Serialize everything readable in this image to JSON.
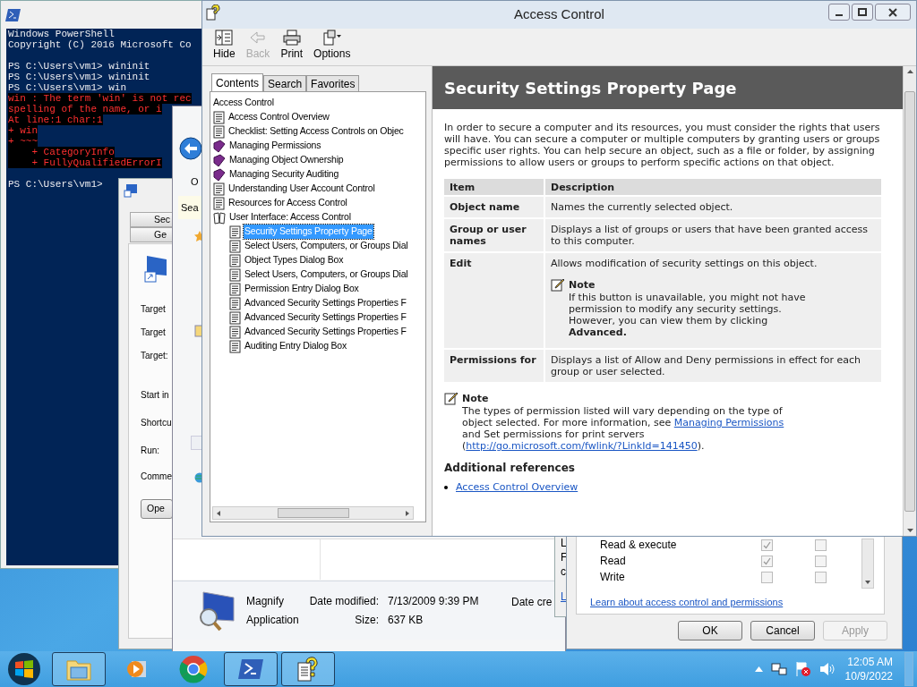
{
  "powershell": {
    "lines": [
      {
        "kind": "output",
        "text": "Windows PowerShell"
      },
      {
        "kind": "output",
        "text": "Copyright (C) 2016 Microsoft Co"
      },
      {
        "kind": "blank"
      },
      {
        "kind": "output",
        "text": "PS C:\\Users\\vm1> wininit"
      },
      {
        "kind": "output",
        "text": "PS C:\\Users\\vm1> wininit"
      },
      {
        "kind": "output",
        "text": "PS C:\\Users\\vm1> win"
      },
      {
        "kind": "error",
        "text": "win : The term 'win' is not rec"
      },
      {
        "kind": "error",
        "text": "spelling of the name, or i"
      },
      {
        "kind": "error",
        "text": "At line:1 char:1"
      },
      {
        "kind": "error",
        "text": "+ win"
      },
      {
        "kind": "error",
        "text": "+ ~~~"
      },
      {
        "kind": "error",
        "text": "    + CategoryInfo"
      },
      {
        "kind": "error",
        "text": "    + FullyQualifiedErrorI"
      },
      {
        "kind": "blank"
      },
      {
        "kind": "output",
        "text": "PS C:\\Users\\vm1>"
      }
    ]
  },
  "shortcut_properties": {
    "tabs": [
      "Sec",
      "Ge"
    ],
    "labels": [
      "Target",
      "Target",
      "Target:",
      "Start in",
      "Shortcu",
      "Run:",
      "Comme"
    ],
    "button": "Ope"
  },
  "explorer": {
    "toolbar_text": "O",
    "search": "Sea",
    "details": {
      "name": "Magnify",
      "type": "Application",
      "modified_label": "Date modified:",
      "modified": "7/13/2009 9:39 PM",
      "size_label": "Size:",
      "size": "637 KB",
      "created_label": "Date cre"
    }
  },
  "back_fragments": [
    "L",
    "F",
    "c",
    "L"
  ],
  "security_dialog": {
    "permissions": [
      {
        "name": "Read & execute",
        "allow": true,
        "deny": false
      },
      {
        "name": "Read",
        "allow": true,
        "deny": false
      },
      {
        "name": "Write",
        "allow": false,
        "deny": false
      }
    ],
    "link": "Learn about access control and permissions",
    "buttons": [
      {
        "label": "OK",
        "disabled": false
      },
      {
        "label": "Cancel",
        "disabled": false
      },
      {
        "label": "Apply",
        "disabled": true
      }
    ]
  },
  "help": {
    "title": "Access Control",
    "toolbar": [
      {
        "kind": "hide",
        "label": "Hide",
        "disabled": false
      },
      {
        "kind": "back",
        "label": "Back",
        "disabled": true
      },
      {
        "kind": "print",
        "label": "Print",
        "disabled": false
      },
      {
        "kind": "options",
        "label": "Options",
        "disabled": false
      }
    ],
    "tabs": [
      {
        "label": "Contents",
        "selected": true
      },
      {
        "label": "Search",
        "selected": false
      },
      {
        "label": "Favorites",
        "selected": false
      }
    ],
    "tree": [
      {
        "label": "Access Control",
        "selected": false,
        "children": [
          {
            "label": "Access Control Overview",
            "kind": "page",
            "selected": false
          },
          {
            "label": "Checklist: Setting Access Controls on Objec",
            "kind": "page",
            "selected": false
          },
          {
            "label": "Managing Permissions",
            "kind": "book",
            "selected": false
          },
          {
            "label": "Managing Object Ownership",
            "kind": "book",
            "selected": false
          },
          {
            "label": "Managing Security Auditing",
            "kind": "book",
            "selected": false
          },
          {
            "label": "Understanding User Account Control",
            "kind": "page",
            "selected": false
          },
          {
            "label": "Resources for Access Control",
            "kind": "page",
            "selected": false
          },
          {
            "label": "User Interface: Access Control",
            "kind": "open-book",
            "selected": false,
            "children": [
              {
                "label": "Security Settings Property Page",
                "kind": "page",
                "selected": true
              },
              {
                "label": "Select Users, Computers, or Groups Dial",
                "kind": "page",
                "selected": false
              },
              {
                "label": "Object Types Dialog Box",
                "kind": "page",
                "selected": false
              },
              {
                "label": "Select Users, Computers, or Groups Dial",
                "kind": "page",
                "selected": false
              },
              {
                "label": "Permission Entry Dialog Box",
                "kind": "page",
                "selected": false
              },
              {
                "label": "Advanced Security Settings Properties F",
                "kind": "page",
                "selected": false
              },
              {
                "label": "Advanced Security Settings Properties F",
                "kind": "page",
                "selected": false
              },
              {
                "label": "Advanced Security Settings Properties F",
                "kind": "page",
                "selected": false
              },
              {
                "label": "Auditing Entry Dialog Box",
                "kind": "page",
                "selected": false
              }
            ]
          }
        ]
      }
    ],
    "content": {
      "title": "Security Settings Property Page",
      "intro": "In order to secure a computer and its resources, you must consider the rights that users will have. You can secure a computer or multiple computers by granting users or groups specific user rights. You can help secure an object, such as a file or folder, by assigning permissions to allow users or groups to perform specific actions on that object.",
      "table": {
        "columns": [
          "Item",
          "Description"
        ],
        "rows": [
          {
            "item": "Object name",
            "description": "Names the currently selected object."
          },
          {
            "item": "Group or user names",
            "description": "Displays a list of groups or users that have been granted access to this computer."
          },
          {
            "item": "Edit",
            "description": "Allows modification of security settings on this object.",
            "note": {
              "heading": "Note",
              "text": "If this button is unavailable, you might not have permission to modify any security settings. However, you can view them by clicking **Advanced.**"
            }
          },
          {
            "item": "Permissions for",
            "description": "Displays a list of Allow and Deny permissions in effect for each group or user selected."
          }
        ]
      },
      "note": {
        "heading": "Note",
        "text_before": "The types of permission listed will vary depending on the type of object selected. For more information, see ",
        "link": "Managing Permissions",
        "text_middle": " and Set permissions for print servers (",
        "link2": "http://go.microsoft.com/fwlink/?LinkId=141450",
        "text_after": ")."
      },
      "references": {
        "heading": "Additional references",
        "links": [
          "Access Control Overview"
        ]
      }
    }
  },
  "taskbar": {
    "items": [
      {
        "kind": "explorer",
        "open": true
      },
      {
        "kind": "media",
        "open": false
      },
      {
        "kind": "chrome",
        "open": false
      },
      {
        "kind": "powershell",
        "open": true
      },
      {
        "kind": "help",
        "open": true
      }
    ],
    "time": "12:05 AM",
    "date": "10/9/2022"
  }
}
